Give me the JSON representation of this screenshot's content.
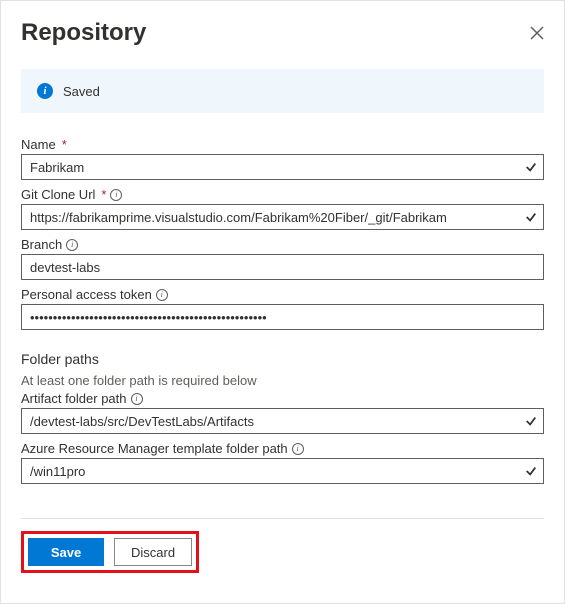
{
  "panel": {
    "title": "Repository",
    "banner_text": "Saved"
  },
  "fields": {
    "name": {
      "label": "Name",
      "value": "Fabrikam",
      "required": true
    },
    "git_clone_url": {
      "label": "Git Clone Url",
      "value": "https://fabrikamprime.visualstudio.com/Fabrikam%20Fiber/_git/Fabrikam",
      "required": true
    },
    "branch": {
      "label": "Branch",
      "value": "devtest-labs"
    },
    "pat": {
      "label": "Personal access token",
      "value": "••••••••••••••••••••••••••••••••••••••••••••••••••••"
    }
  },
  "folder_section": {
    "title": "Folder paths",
    "helper": "At least one folder path is required below",
    "artifact": {
      "label": "Artifact folder path",
      "value": "/devtest-labs/src/DevTestLabs/Artifacts"
    },
    "arm": {
      "label": "Azure Resource Manager template folder path",
      "value": "/win11pro"
    }
  },
  "buttons": {
    "save": "Save",
    "discard": "Discard"
  }
}
